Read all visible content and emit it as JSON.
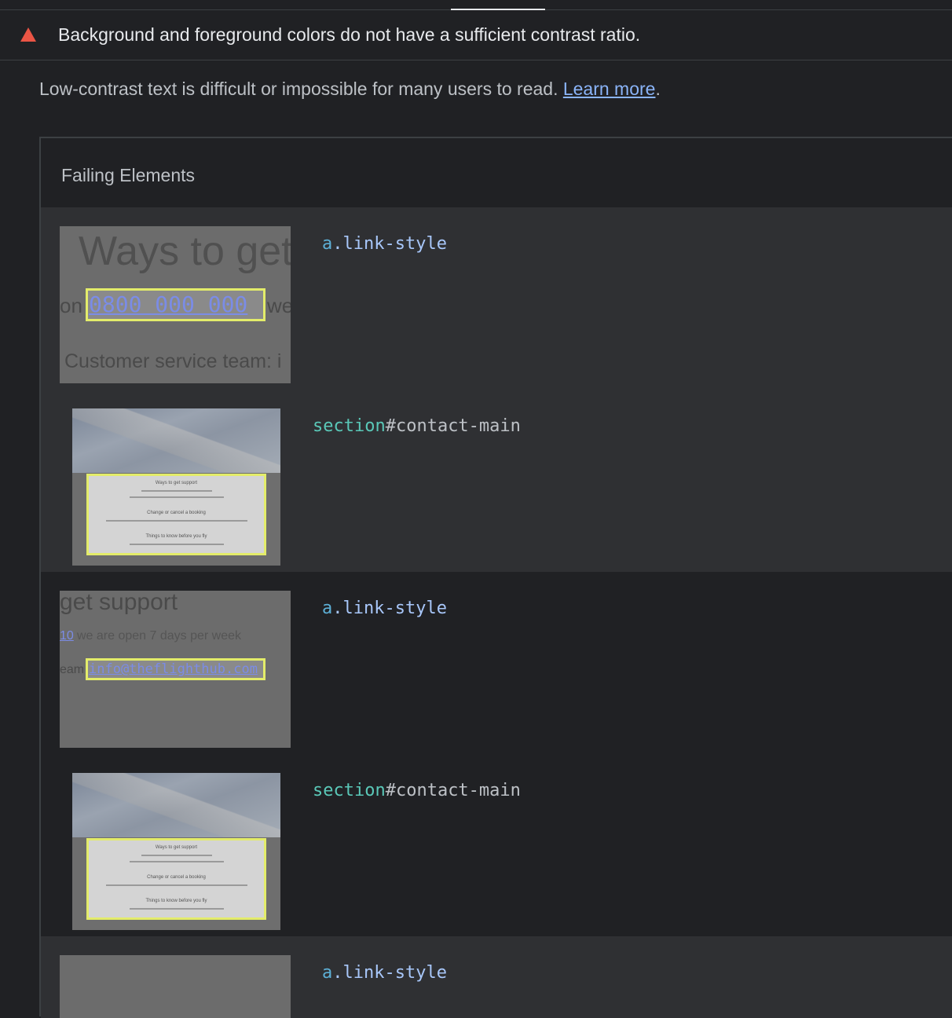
{
  "audit": {
    "title": "Background and foreground colors do not have a sufficient contrast ratio.",
    "status_icon": "fail-triangle-icon",
    "status_color": "#eb5545"
  },
  "description": {
    "text": "Low-contrast text is difficult or impossible for many users to read. ",
    "link_label": "Learn more",
    "suffix": "."
  },
  "table": {
    "header": "Failing Elements",
    "rows": [
      {
        "selector_tag": "a",
        "selector_rest": ".link-style",
        "snippet": {
          "heading": "Ways to get",
          "prefix": "on",
          "link": "0800 000 000",
          "suffix": "we",
          "footer": "Customer service team: i"
        }
      },
      {
        "selector_tag": "section",
        "selector_rest": "#contact-main",
        "card": {
          "line1": "Ways to get support",
          "line2": "Change or cancel a booking",
          "line3": "Things to know before you fly"
        }
      },
      {
        "selector_tag": "a",
        "selector_rest": ".link-style",
        "snippet": {
          "heading": "get support",
          "line": "we are open 7 days per week",
          "prefix_link": "10",
          "prefix": "eam",
          "link": "info@theflighthub.com"
        }
      },
      {
        "selector_tag": "section",
        "selector_rest": "#contact-main",
        "card": {
          "line1": "Ways to get support",
          "line2": "Change or cancel a booking",
          "line3": "Things to know before you fly"
        }
      },
      {
        "selector_tag": "a",
        "selector_rest": ".link-style"
      }
    ]
  }
}
